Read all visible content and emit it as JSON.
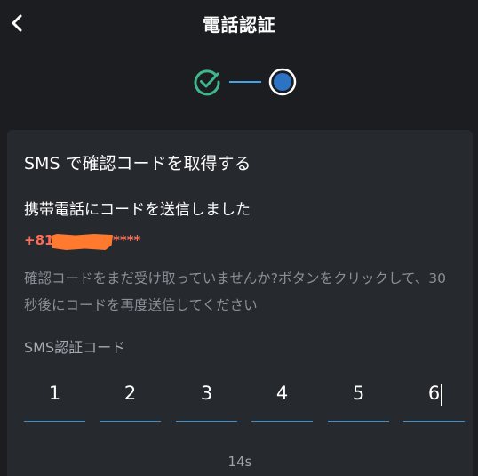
{
  "header": {
    "title": "電話認証",
    "back_icon": "chevron-left-icon"
  },
  "stepper": {
    "step1_icon": "check-circle-icon",
    "step1_color": "#3fb68b",
    "step2_icon": "radio-dot-icon",
    "step2_color": "#2d73c4",
    "line_color": "#45a3e6"
  },
  "card": {
    "title": "SMS で確認コードを取得する",
    "sent_message": "携帯電話にコードを送信しました",
    "phone": {
      "prefix": "+81",
      "suffix": "****",
      "color": "#ff6b55"
    },
    "hint": "確認コードをまだ受け取っていませんか?ボタンをクリックして、30秒後にコードを再度送信してください",
    "code_label": "SMS認証コード",
    "code_digits": [
      "1",
      "2",
      "3",
      "4",
      "5",
      "6"
    ],
    "timer": "14s"
  }
}
